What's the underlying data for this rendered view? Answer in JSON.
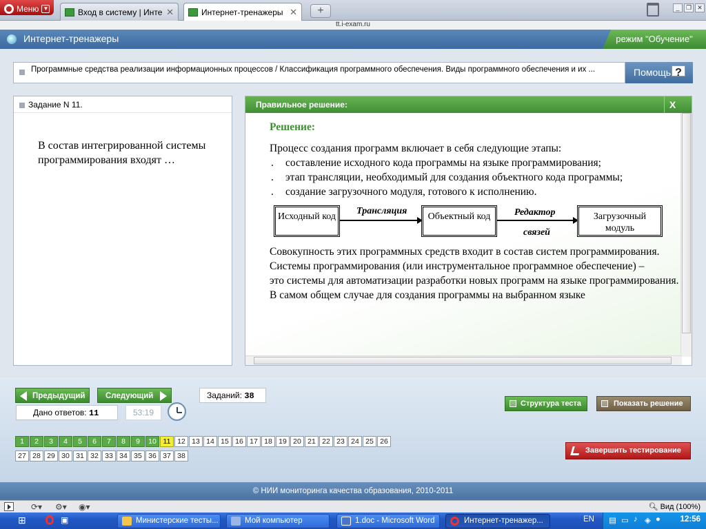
{
  "browser": {
    "menu_label": "Меню",
    "tabs": [
      {
        "title": "Вход в систему | Интер...",
        "active": false
      },
      {
        "title": "Интернет-тренажеры",
        "active": true
      }
    ],
    "new_tab_label": "+",
    "url": "tt.i-exam.ru"
  },
  "app": {
    "title": "Интернет-тренажеры",
    "mode": "режим \"Обучение\"",
    "breadcrumb": "Программные средства реализации информационных процессов / Классификация программного обеспечения. Виды программного обеспечения и их ...",
    "help_label": "Помощь",
    "help_icon": "?"
  },
  "task": {
    "header": "Задание N 11.",
    "question": "В состав интегрированной системы программирования входят …"
  },
  "solution": {
    "header": "Правильное решение:",
    "close_label": "X",
    "title": "Решение:",
    "intro": "Процесс создания программ включает в себя следующие этапы:",
    "bullets": [
      "составление исходного кода программы на языке программирования;",
      "этап трансляции, необходимый для создания объектного кода программы;",
      "создание загрузочного модуля, готового к исполнению."
    ],
    "bullet_marker": ".",
    "diagram": {
      "box1": "Исходный код",
      "arrow1": "Трансляция",
      "box2": "Объектный код",
      "arrow2_line1": "Редактор",
      "arrow2_line2": "связей",
      "box3": "Загрузочный модуль"
    },
    "paragraphs": [
      "Совокупность этих программных средств входит в состав систем программирования.",
      "Системы программирования (или инструментальное программное обеспечение) –",
      "это системы для автоматизации разработки новых программ на языке программирования.",
      "В самом общем случае для создания программы на выбранном языке"
    ]
  },
  "navigation": {
    "prev_label": "Предыдущий",
    "next_label": "Следующий",
    "tasks_count_label": "Заданий:",
    "tasks_count": "38",
    "answers_label": "Дано ответов:",
    "answers_count": "11",
    "timer": "53:19",
    "structure_label": "Структура теста",
    "show_solution_label": "Показать решение",
    "finish_label": "Завершить тестирование",
    "current_question": 11,
    "answered_up_to": 10,
    "row1": [
      "1",
      "2",
      "3",
      "4",
      "5",
      "6",
      "7",
      "8",
      "9",
      "10",
      "11",
      "12",
      "13",
      "14",
      "15",
      "16",
      "17",
      "18",
      "19",
      "20",
      "21",
      "22",
      "23",
      "24",
      "25",
      "26"
    ],
    "row2": [
      "27",
      "28",
      "29",
      "30",
      "31",
      "32",
      "33",
      "34",
      "35",
      "36",
      "37",
      "38"
    ]
  },
  "footer": "© НИИ мониторинга качества образования, 2010-2011",
  "status_bar": {
    "zoom": "Вид (100%)"
  },
  "taskbar": {
    "items": [
      {
        "label": "Министерские тесты...",
        "active": false
      },
      {
        "label": "Мой компьютер",
        "active": false
      },
      {
        "label": "1.doc - Microsoft Word",
        "active": false
      },
      {
        "label": "Интернет-тренажер...",
        "active": true
      }
    ],
    "lang": "EN",
    "clock": "12:56"
  },
  "colors": {
    "accent_green": "#4fa23f",
    "header_blue": "#4a78ad",
    "answered": "#5aab48",
    "current": "#f3ee35",
    "finish_red": "#c62828"
  }
}
